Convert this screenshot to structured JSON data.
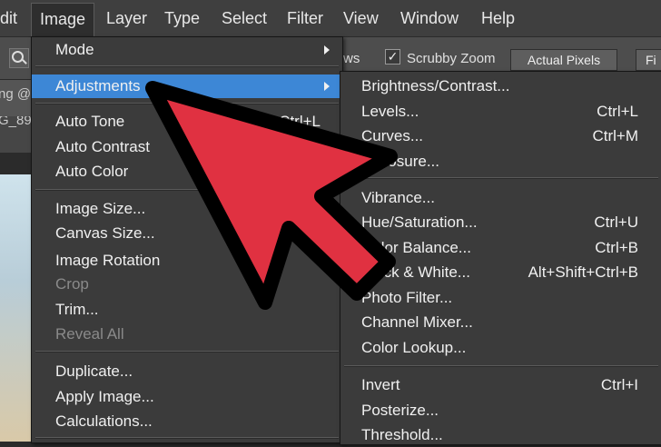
{
  "menubar": {
    "items": [
      {
        "label": "dit",
        "active": false
      },
      {
        "label": "Image",
        "active": true
      },
      {
        "label": "Layer",
        "active": false
      },
      {
        "label": "Type",
        "active": false
      },
      {
        "label": "Select",
        "active": false
      },
      {
        "label": "Filter",
        "active": false
      },
      {
        "label": "View",
        "active": false
      },
      {
        "label": "Window",
        "active": false
      },
      {
        "label": "Help",
        "active": false
      }
    ]
  },
  "options_bar": {
    "fragments": [
      "ws"
    ],
    "scrubby_zoom": {
      "label": "Scrubby Zoom",
      "checked": true,
      "check_glyph": "✓"
    },
    "actual_pixels_label": "Actual Pixels",
    "fit_label": "Fi"
  },
  "document": {
    "tab_fragments": [
      "ng @",
      "G_89"
    ]
  },
  "image_menu": {
    "items": [
      {
        "label": "Mode",
        "submenu": true
      },
      {
        "label": "Adjustments",
        "submenu": true,
        "highlighted": true
      },
      {
        "label": "Auto Tone",
        "shortcut": "Shift+Ctrl+L"
      },
      {
        "label": "Auto Contrast"
      },
      {
        "label": "Auto Color"
      },
      {
        "label": "Image Size..."
      },
      {
        "label": "Canvas Size..."
      },
      {
        "label": "Image Rotation"
      },
      {
        "label": "Crop",
        "disabled": true
      },
      {
        "label": "Trim..."
      },
      {
        "label": "Reveal All",
        "disabled": true
      },
      {
        "label": "Duplicate..."
      },
      {
        "label": "Apply Image..."
      },
      {
        "label": "Calculations..."
      }
    ]
  },
  "adjustments_menu": {
    "items": [
      {
        "label": "Brightness/Contrast...",
        "shortcut": ""
      },
      {
        "label": "Levels...",
        "shortcut": "Ctrl+L"
      },
      {
        "label": "Curves...",
        "shortcut": "Ctrl+M"
      },
      {
        "label": "Exposure...",
        "shortcut": ""
      },
      {
        "label": "Vibrance...",
        "shortcut": ""
      },
      {
        "label": "Hue/Saturation...",
        "shortcut": "Ctrl+U"
      },
      {
        "label": "Color Balance...",
        "shortcut": "Ctrl+B"
      },
      {
        "label": "Black & White...",
        "shortcut": "Alt+Shift+Ctrl+B"
      },
      {
        "label": "Photo Filter...",
        "shortcut": ""
      },
      {
        "label": "Channel Mixer...",
        "shortcut": ""
      },
      {
        "label": "Color Lookup...",
        "shortcut": ""
      },
      {
        "label": "Invert",
        "shortcut": "Ctrl+I"
      },
      {
        "label": "Posterize...",
        "shortcut": ""
      },
      {
        "label": "Threshold...",
        "shortcut": ""
      }
    ]
  },
  "colors": {
    "highlight": "#3d87d6",
    "pointer_fill": "#e03141",
    "pointer_outline": "#000000"
  },
  "icons": {
    "zoom": "magnifier-icon",
    "submenu": "chevron-right-icon",
    "pointer": "red-arrow-pointer-icon"
  }
}
